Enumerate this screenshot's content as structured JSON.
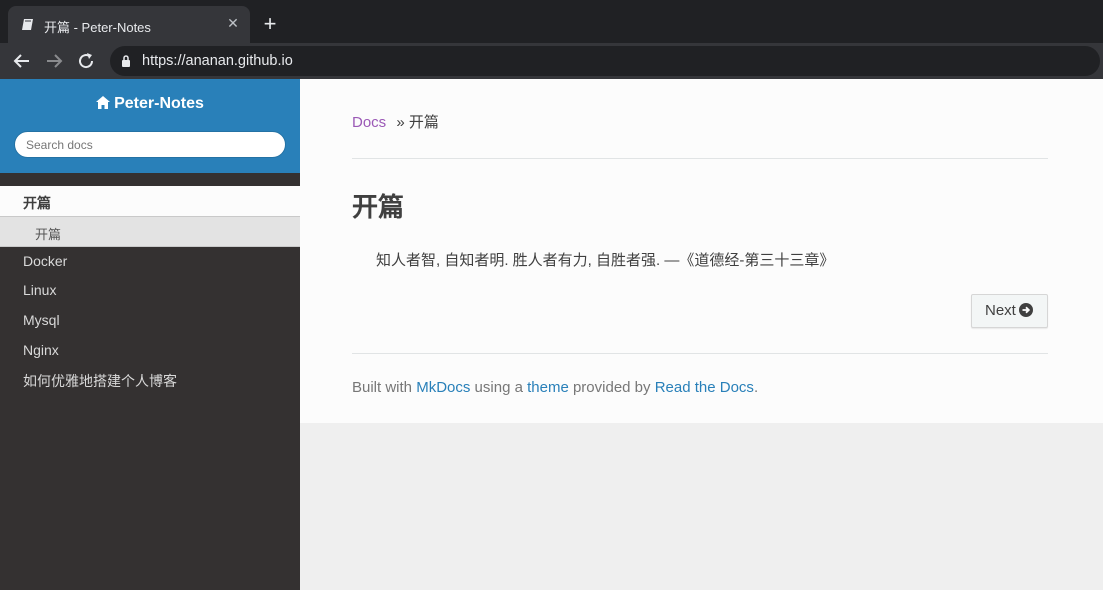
{
  "browser": {
    "tab_title": "开篇 - Peter-Notes",
    "close_glyph": "✕",
    "new_tab_glyph": "+",
    "url": "https://ananan.github.io"
  },
  "sidebar": {
    "brand": "Peter-Notes",
    "search_placeholder": "Search docs",
    "current_section": "开篇",
    "current_subsection": "开篇",
    "items": [
      {
        "label": "Docker"
      },
      {
        "label": "Linux"
      },
      {
        "label": "Mysql"
      },
      {
        "label": "Nginx"
      },
      {
        "label": "如何优雅地搭建个人博客"
      }
    ]
  },
  "main": {
    "breadcrumb_home": "Docs",
    "breadcrumb_sep": "»",
    "breadcrumb_current": "开篇",
    "title": "开篇",
    "quote": "知人者智, 自知者明. 胜人者有力, 自胜者强. —《道德经-第三十三章》",
    "next_label": "Next"
  },
  "footer": {
    "built_with": "Built with",
    "mkdocs": "MkDocs",
    "using_a": "using a",
    "theme": "theme",
    "provided_by": "provided by",
    "rtd": "Read the Docs",
    "period": "."
  },
  "colors": {
    "sidebar_bg": "#343131",
    "brand_bg": "#2980b9",
    "link_blue": "#2980b9",
    "link_purple": "#9b59b6"
  },
  "icons": [
    "book-icon",
    "close-icon",
    "plus-icon",
    "back-arrow-icon",
    "forward-arrow-icon",
    "reload-icon",
    "lock-icon",
    "home-icon",
    "arrow-circle-right-icon"
  ]
}
